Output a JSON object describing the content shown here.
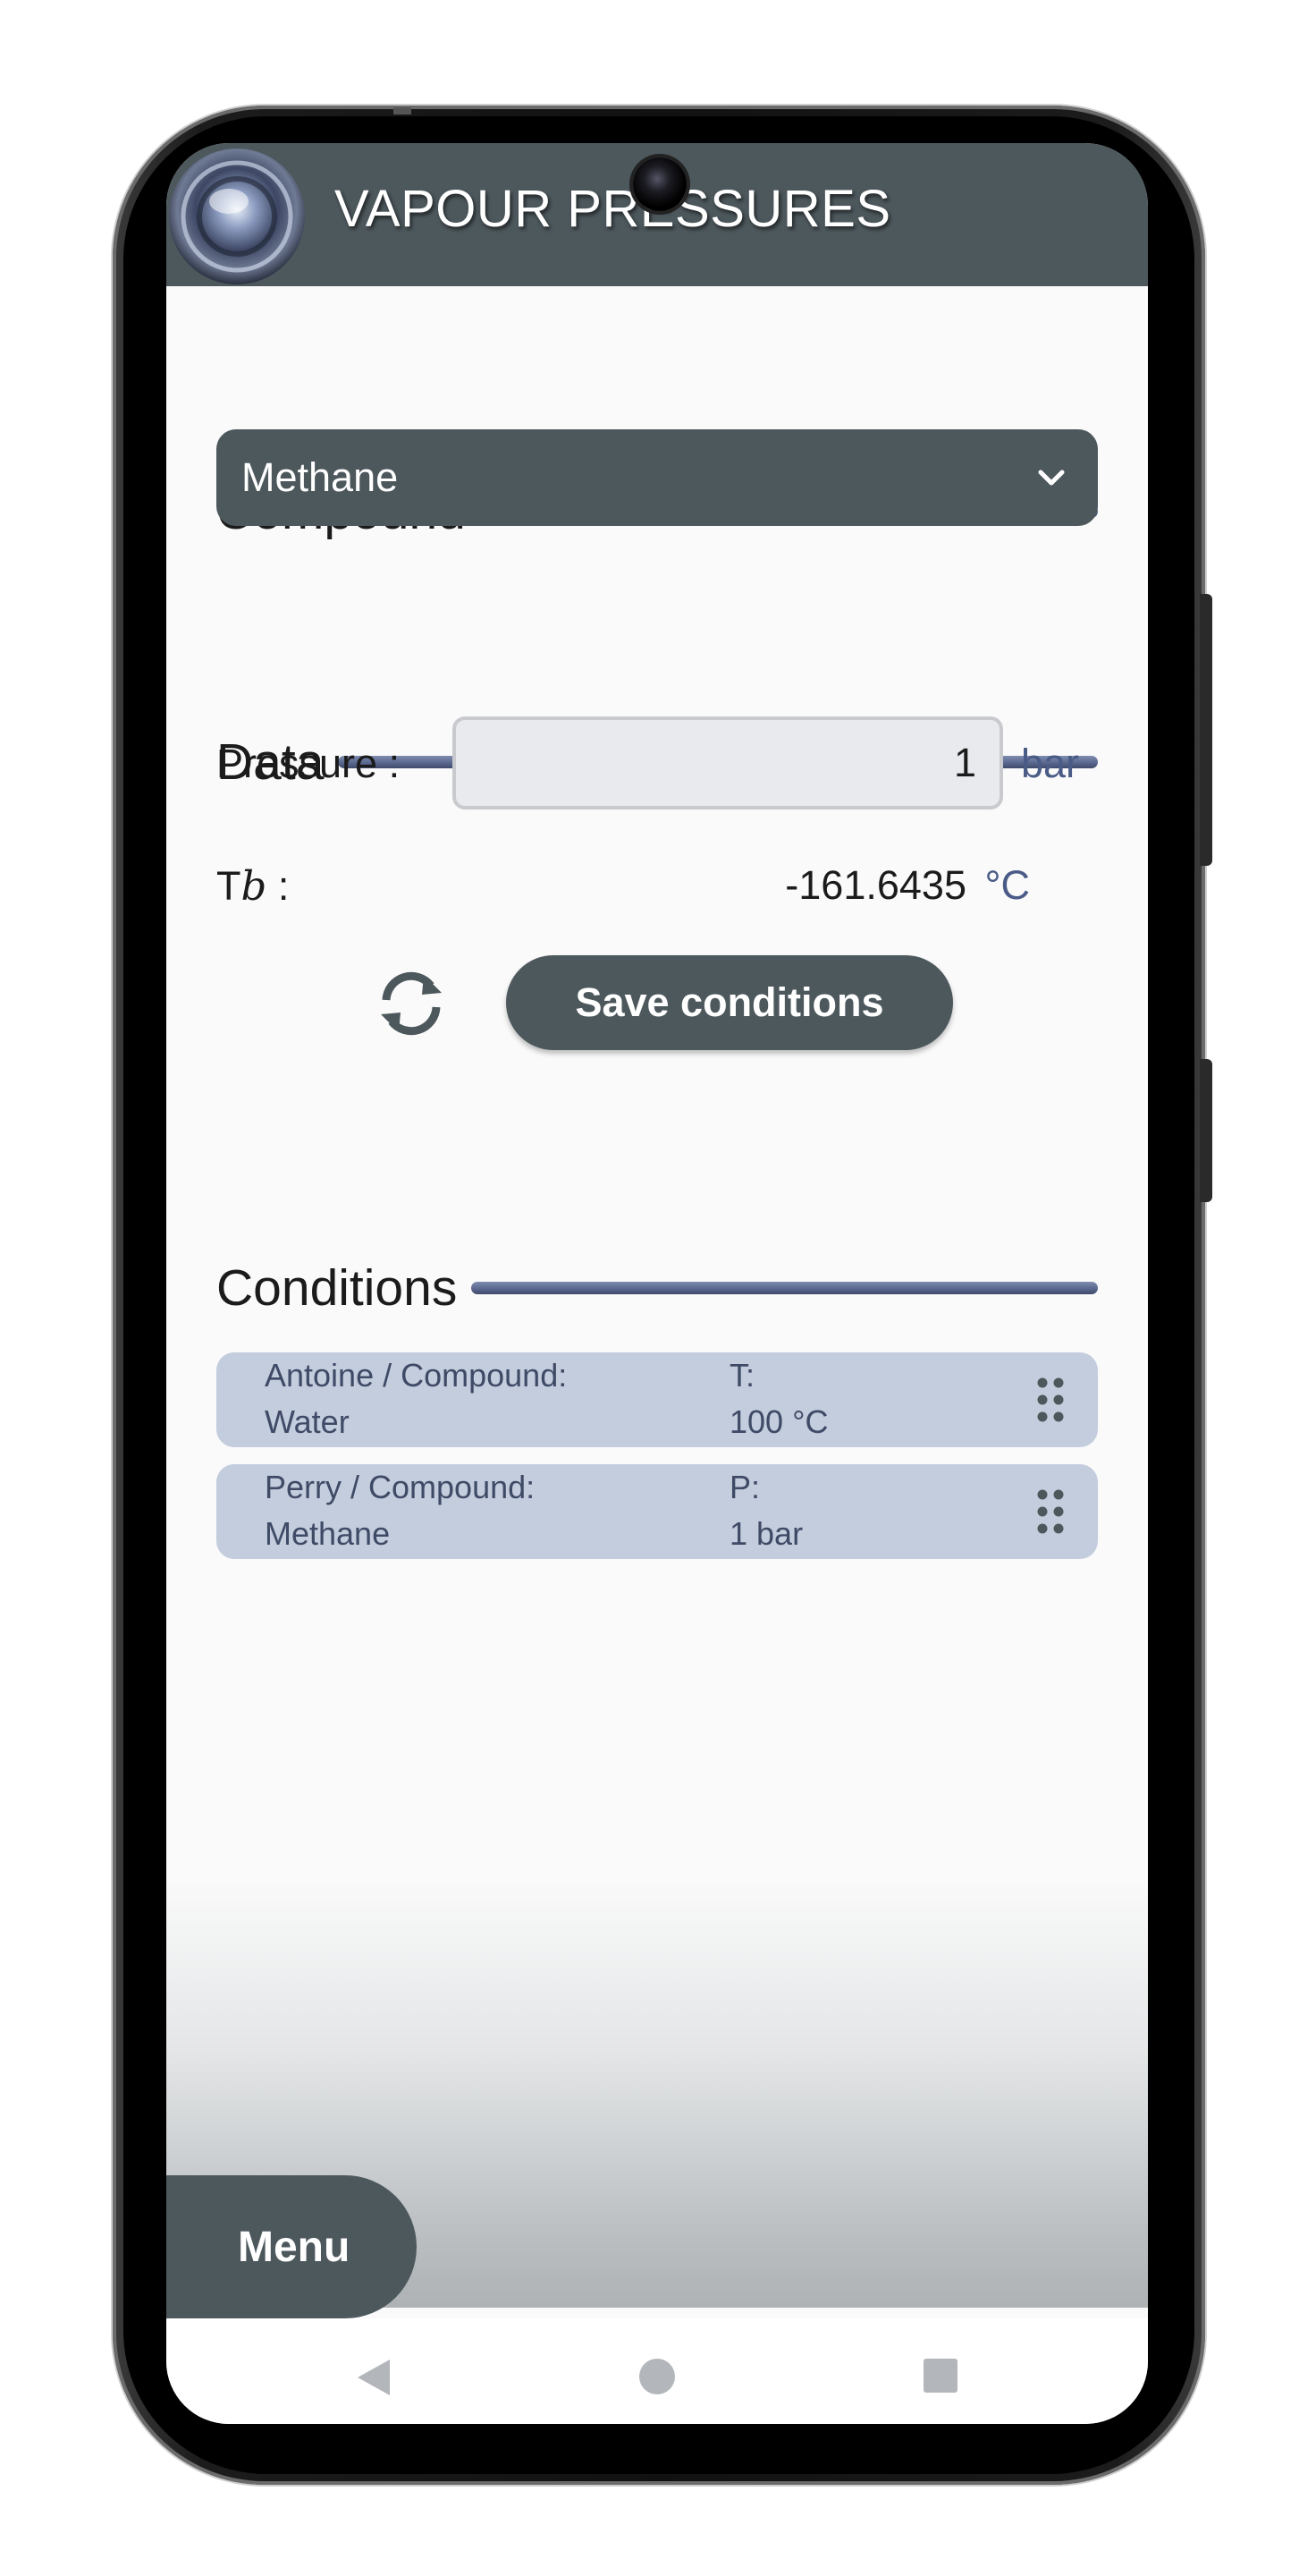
{
  "app": {
    "title": "VAPOUR PRESSURES"
  },
  "compound": {
    "heading": "Compound",
    "selected": "Methane"
  },
  "data": {
    "heading": "Data",
    "pressure_label": "Pressure :",
    "pressure_value": "1",
    "pressure_unit": "bar",
    "tb_label_prefix": "T",
    "tb_label_sub": "b",
    "tb_label_suffix": " :",
    "tb_value": "-161.6435",
    "tb_unit": "°C"
  },
  "actions": {
    "save_label": "Save conditions"
  },
  "conditions": {
    "heading": "Conditions",
    "items": [
      {
        "method": "Antoine / Compound:",
        "compound": "Water",
        "var_label": "T:",
        "var_value": "100 °C"
      },
      {
        "method": "Perry / Compound:",
        "compound": "Methane",
        "var_label": "P:",
        "var_value": "1 bar"
      }
    ]
  },
  "menu": {
    "label": "Menu"
  },
  "colors": {
    "header": "#4d585d",
    "accent_rule": "#58658c",
    "card": "#c4cddd",
    "unit_text": "#4a5b86"
  },
  "icons": {
    "logo": "app-logo-orb",
    "dropdown": "chevron-down-icon",
    "refresh": "refresh-icon",
    "drag": "drag-handle-icon",
    "nav_back": "back-triangle-icon",
    "nav_home": "home-circle-icon",
    "nav_recent": "recents-square-icon"
  }
}
